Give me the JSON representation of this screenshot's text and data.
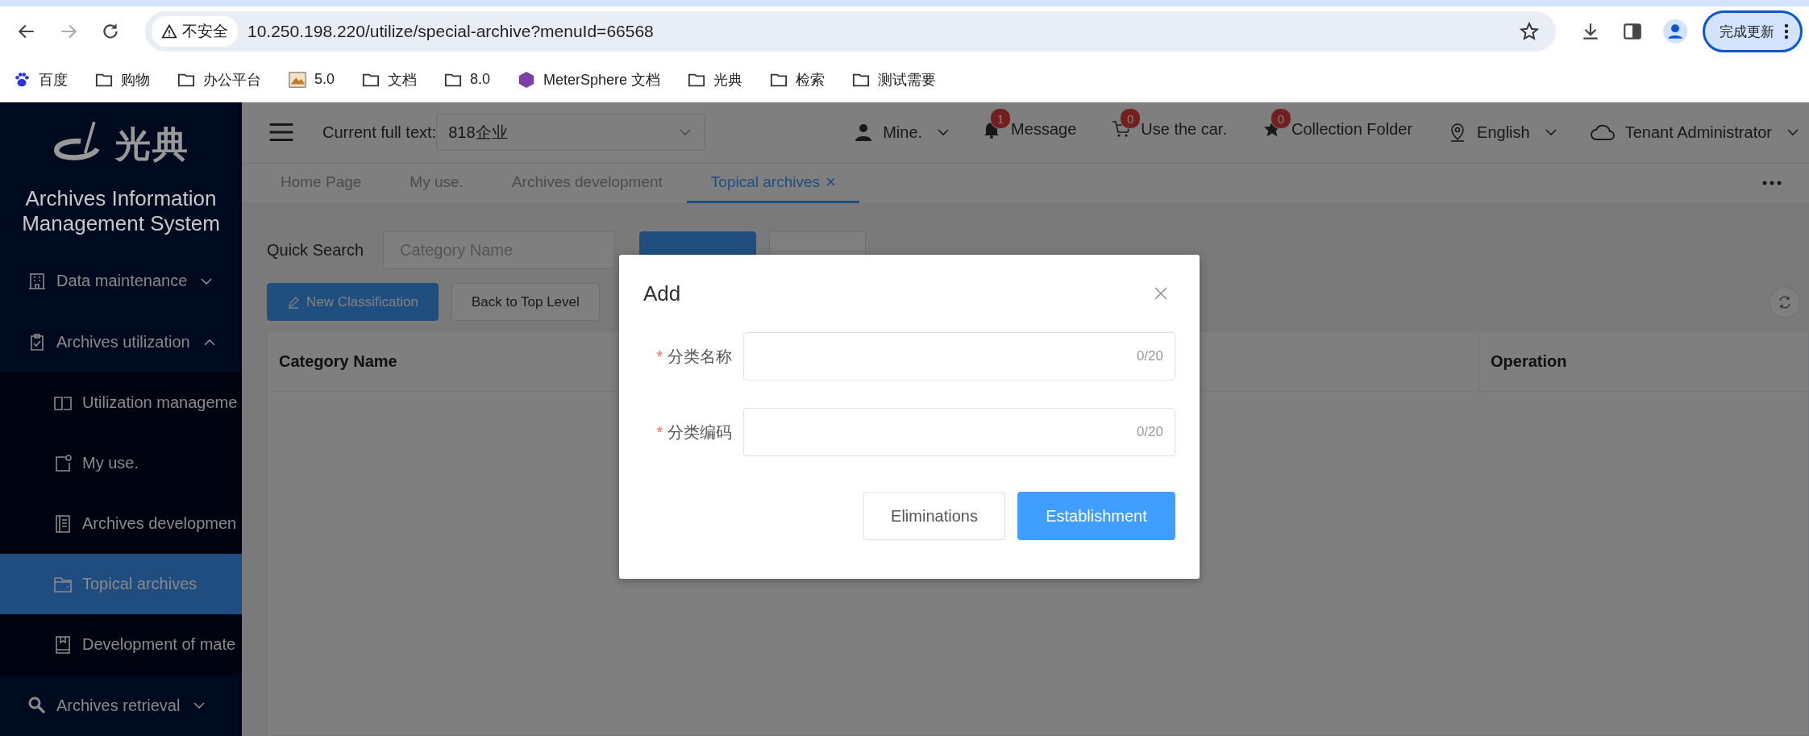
{
  "browser": {
    "security_label": "不安全",
    "url": "10.250.198.220/utilize/special-archive?menuId=66568",
    "update_button": "完成更新",
    "bookmarks": [
      {
        "label": "百度",
        "kind": "site"
      },
      {
        "label": "购物",
        "kind": "folder"
      },
      {
        "label": "办公平台",
        "kind": "folder"
      },
      {
        "label": "5.0",
        "kind": "site"
      },
      {
        "label": "文档",
        "kind": "folder"
      },
      {
        "label": "8.0",
        "kind": "folder"
      },
      {
        "label": "MeterSphere 文档",
        "kind": "site"
      },
      {
        "label": "光典",
        "kind": "folder"
      },
      {
        "label": "检索",
        "kind": "folder"
      },
      {
        "label": "测试需要",
        "kind": "folder"
      }
    ]
  },
  "sidebar": {
    "logo_text": "光典",
    "title": "Archives Information Management System",
    "menu": [
      {
        "label": "Data maintenance",
        "expanded": false
      },
      {
        "label": "Archives utilization",
        "expanded": true,
        "children": [
          {
            "label": "Utilization manageme",
            "selected": false
          },
          {
            "label": "My use.",
            "selected": false
          },
          {
            "label": "Archives developmen",
            "selected": false
          },
          {
            "label": "Topical archives",
            "selected": true
          },
          {
            "label": "Development of mate",
            "selected": false
          }
        ]
      },
      {
        "label": "Archives retrieval",
        "expanded": false
      }
    ]
  },
  "header": {
    "company_label": "Current full text:",
    "company_value": "818企业",
    "user": "Mine.",
    "notices": [
      {
        "label": "Message",
        "count": "1"
      },
      {
        "label": "Use the car.",
        "count": "0"
      },
      {
        "label": "Collection Folder",
        "count": "0"
      }
    ],
    "language": "English",
    "role": "Tenant Administrator"
  },
  "tabs": [
    {
      "label": "Home Page",
      "selected": false
    },
    {
      "label": "My use.",
      "selected": false
    },
    {
      "label": "Archives development",
      "selected": false
    },
    {
      "label": "Topical archives",
      "selected": true
    }
  ],
  "content": {
    "quick_search_label": "Quick Search",
    "search_placeholder": "Category Name",
    "buttons": [
      {
        "label": "New Classification",
        "kind": "primary"
      },
      {
        "label": "Back to Top Level",
        "kind": "default"
      }
    ],
    "table": {
      "columns": [
        "Category Name",
        "Operation"
      ]
    }
  },
  "dialog": {
    "title": "Add",
    "fields": [
      {
        "label": "分类名称",
        "required_mark": "*",
        "counter": "0/20"
      },
      {
        "label": "分类编码",
        "required_mark": "*",
        "counter": "0/20"
      }
    ],
    "buttons": [
      {
        "label": "Eliminations",
        "kind": "default"
      },
      {
        "label": "Establishment",
        "kind": "primary"
      }
    ]
  }
}
